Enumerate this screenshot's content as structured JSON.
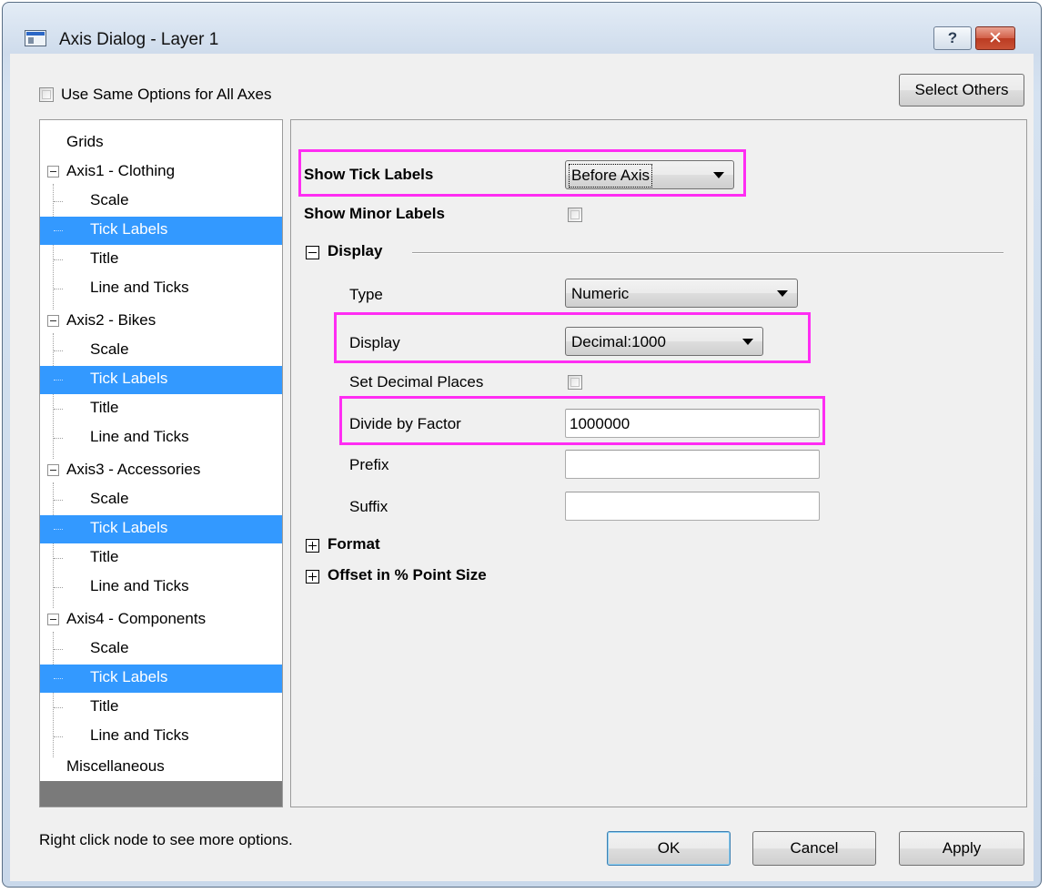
{
  "window": {
    "title": "Axis Dialog - Layer 1",
    "help_label": "?",
    "close_label": "✕"
  },
  "top": {
    "same_options_label": "Use Same Options for All Axes",
    "same_options_checked": false,
    "select_others_label": "Select Others"
  },
  "tree": {
    "grids": "Grids",
    "axis1": "Axis1 - Clothing",
    "axis2": "Axis2 - Bikes",
    "axis3": "Axis3 - Accessories",
    "axis4": "Axis4 - Components",
    "misc": "Miscellaneous",
    "child_scale": "Scale",
    "child_tick_labels": "Tick Labels",
    "child_title": "Title",
    "child_line_ticks": "Line and Ticks",
    "selected": "Tick Labels"
  },
  "panel": {
    "show_tick_labels_label": "Show Tick Labels",
    "show_tick_labels_value": "Before Axis",
    "show_minor_labels_label": "Show Minor Labels",
    "show_minor_labels_checked": false,
    "display_section": "Display",
    "type_label": "Type",
    "type_value": "Numeric",
    "display_label": "Display",
    "display_value": "Decimal:1000",
    "set_decimal_label": "Set Decimal Places",
    "set_decimal_checked": false,
    "divide_label": "Divide by Factor",
    "divide_value": "1000000",
    "prefix_label": "Prefix",
    "prefix_value": "",
    "suffix_label": "Suffix",
    "suffix_value": "",
    "format_section": "Format",
    "offset_section": "Offset in % Point Size"
  },
  "footer": {
    "hint": "Right click node to see more options.",
    "ok": "OK",
    "cancel": "Cancel",
    "apply": "Apply"
  },
  "colors": {
    "highlight_box": "#ff2df3",
    "selection": "#3399ff"
  }
}
